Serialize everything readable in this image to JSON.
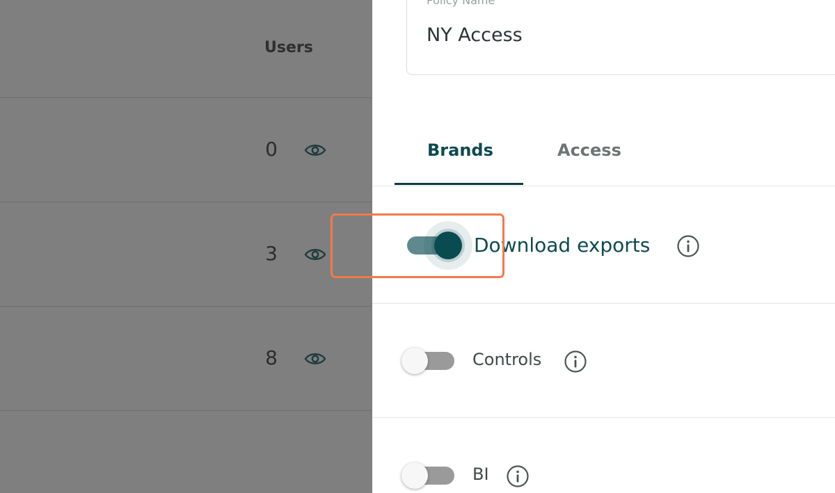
{
  "backdrop": {
    "column_header": "Users",
    "rows": [
      {
        "count": "0"
      },
      {
        "count": "3"
      },
      {
        "count": "8"
      }
    ]
  },
  "panel": {
    "name_field": {
      "label": "Policy Name",
      "value": "NY Access"
    },
    "tabs": [
      {
        "label": "Brands",
        "active": true
      },
      {
        "label": "Access",
        "active": false
      }
    ],
    "permissions": [
      {
        "label": "Download exports",
        "enabled": true
      },
      {
        "label": "Controls",
        "enabled": false
      },
      {
        "label": "BI",
        "enabled": false
      }
    ]
  },
  "colors": {
    "accent": "#0a4b52",
    "highlight": "#f27a4a",
    "overlay": "#7f7f7f"
  }
}
